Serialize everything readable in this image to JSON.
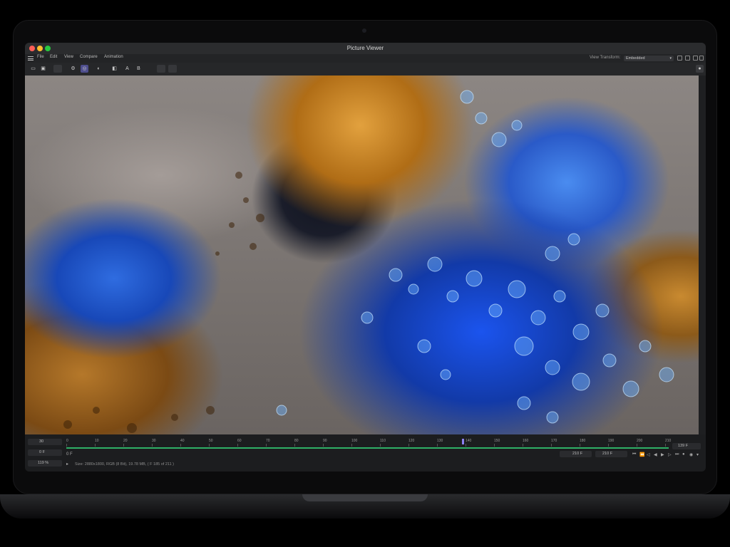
{
  "window": {
    "title": "Picture Viewer"
  },
  "menu": {
    "items": [
      "File",
      "Edit",
      "View",
      "Compare",
      "Animation"
    ]
  },
  "view_transform": {
    "label": "View Transform:",
    "value": "Embedded"
  },
  "toolbar": {
    "text_buttons": [
      "A",
      "B"
    ]
  },
  "timeline": {
    "start_frame": "30",
    "current_frame": "0 F",
    "zoom": "119 %",
    "in_point_label": "0 F",
    "ruler_ticks": [
      "0",
      "10",
      "20",
      "30",
      "40",
      "50",
      "60",
      "70",
      "80",
      "90",
      "100",
      "110",
      "120",
      "130",
      "140",
      "150",
      "160",
      "170",
      "180",
      "190",
      "200",
      "210"
    ],
    "playhead_frame": 139,
    "playhead_label": "139 F",
    "end_box_a": "210 F",
    "end_box_b": "210 F",
    "status": "Size: 2880x1800, RGB (8 Bit), 19.78 MB,  ( F 185 of 211 )"
  }
}
